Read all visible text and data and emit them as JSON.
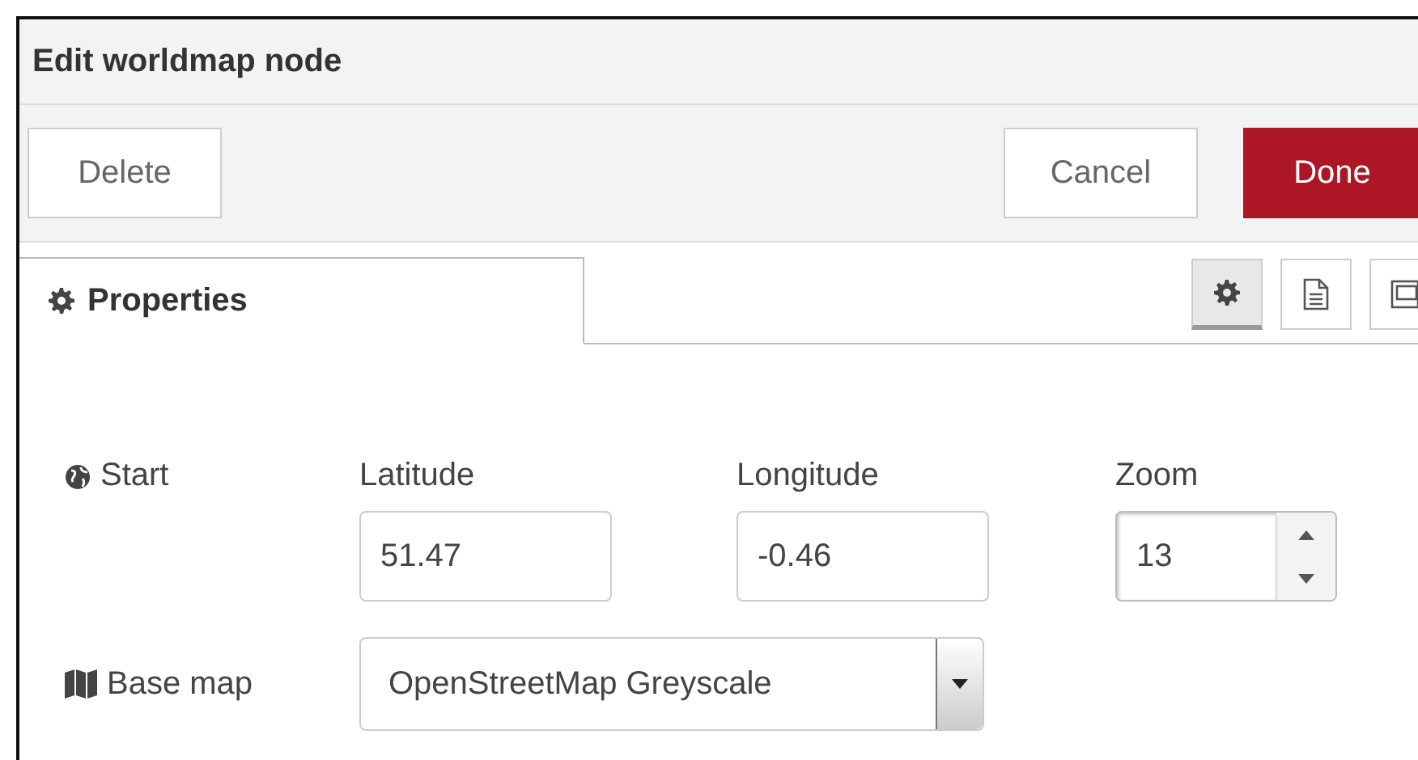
{
  "dialog": {
    "title": "Edit worldmap node"
  },
  "buttons": [
    {
      "label": "Delete",
      "kind": "plain"
    },
    {
      "label": "Cancel",
      "kind": "plain"
    },
    {
      "label": "Done",
      "kind": "primary"
    }
  ],
  "tabs": [
    {
      "label": "Properties",
      "selected": true
    }
  ],
  "tab_icons": [
    {
      "kind": "gear",
      "selected": true
    },
    {
      "kind": "document",
      "selected": false
    },
    {
      "kind": "frame",
      "selected": false
    }
  ],
  "start": {
    "label": "Start",
    "latitude": {
      "label": "Latitude",
      "value": "51.47"
    },
    "longitude": {
      "label": "Longitude",
      "value": "-0.46"
    },
    "zoom": {
      "label": "Zoom",
      "value": "13"
    }
  },
  "base_map": {
    "label": "Base map",
    "value": "OpenStreetMap Greyscale"
  }
}
